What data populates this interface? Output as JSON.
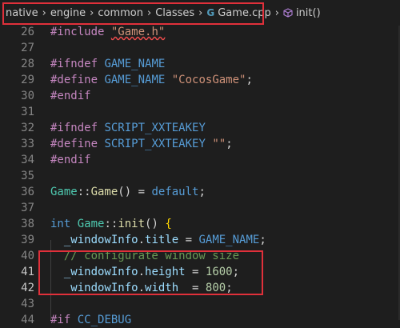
{
  "breadcrumb": {
    "items": [
      "native",
      "engine",
      "common",
      "Classes",
      "Game.cpp",
      "init()"
    ],
    "file_icon": "G"
  },
  "code": {
    "lines": [
      {
        "n": "26",
        "t": "#include \"Game.h\""
      },
      {
        "n": "27",
        "t": ""
      },
      {
        "n": "28",
        "t": "#ifndef GAME_NAME"
      },
      {
        "n": "29",
        "t": "#define GAME_NAME \"CocosGame\";"
      },
      {
        "n": "30",
        "t": "#endif"
      },
      {
        "n": "31",
        "t": ""
      },
      {
        "n": "32",
        "t": "#ifndef SCRIPT_XXTEAKEY"
      },
      {
        "n": "33",
        "t": "#define SCRIPT_XXTEAKEY \"\";"
      },
      {
        "n": "34",
        "t": "#endif"
      },
      {
        "n": "35",
        "t": ""
      },
      {
        "n": "36",
        "t": "Game::Game() = default;"
      },
      {
        "n": "37",
        "t": ""
      },
      {
        "n": "38",
        "t": "int Game::init() {"
      },
      {
        "n": "39",
        "t": "  _windowInfo.title = GAME_NAME;"
      },
      {
        "n": "40",
        "t": "  // configurate window size"
      },
      {
        "n": "41",
        "t": "  _windowInfo.height = 1600;"
      },
      {
        "n": "42",
        "t": "  _windowInfo.width  = 800;"
      },
      {
        "n": "43",
        "t": ""
      },
      {
        "n": "44",
        "t": "#if CC_DEBUG"
      }
    ]
  },
  "colors": {
    "highlight_box": "#e0303a",
    "background": "#1e1e1e"
  }
}
